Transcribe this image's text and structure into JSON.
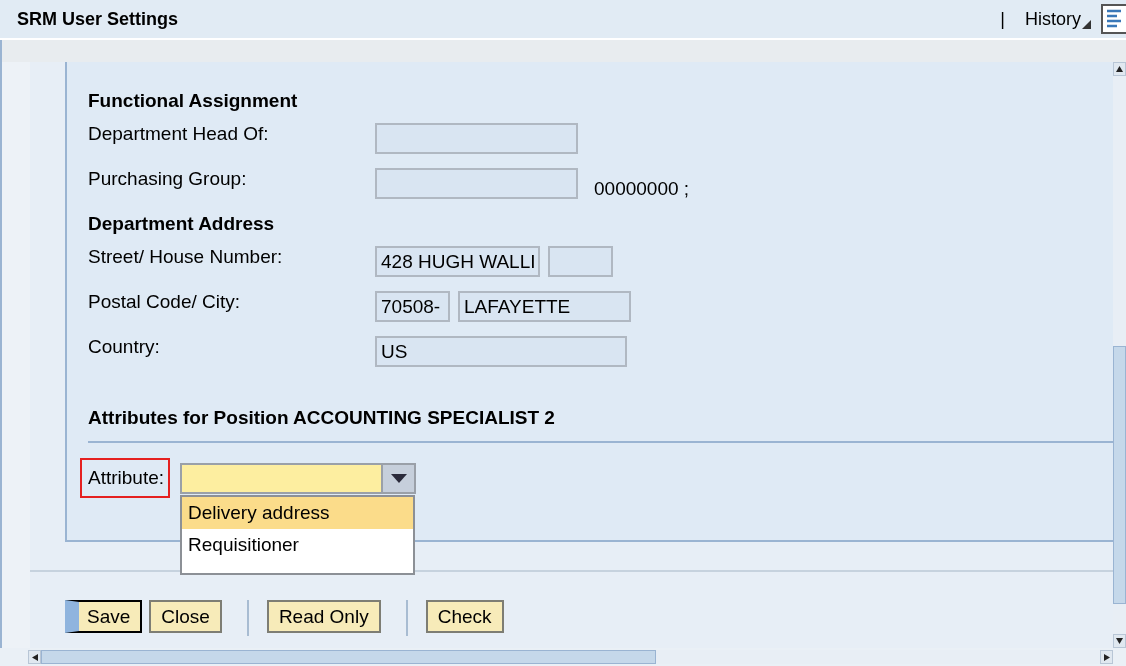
{
  "window": {
    "title": "SRM User Settings"
  },
  "header": {
    "separator": "|",
    "history": "History"
  },
  "sections": [
    {
      "heading": "Functional Assignment",
      "rows": [
        {
          "label": "Department Head Of:"
        },
        {
          "label": "Purchasing Group:",
          "after": "00000000 ;"
        }
      ]
    },
    {
      "heading": "Department Address",
      "rows": [
        {
          "label": "Street/ House Number:",
          "values": [
            "428 HUGH WALLI"
          ]
        },
        {
          "label": "Postal Code/ City:",
          "values": [
            "70508-",
            "LAFAYETTE"
          ]
        },
        {
          "label": "Country:",
          "values": [
            "US"
          ]
        }
      ]
    }
  ],
  "attributes": {
    "heading": "Attributes for Position ACCOUNTING SPECIALIST 2",
    "label": "Attribute:",
    "options": [
      {
        "label": "Delivery address",
        "selected": true
      },
      {
        "label": "Requisitioner",
        "selected": false
      }
    ]
  },
  "buttons": [
    {
      "label": "Save",
      "focused": true
    },
    {
      "label": "Close",
      "focused": false
    },
    {
      "label": "Read Only",
      "focused": false
    },
    {
      "label": "Check",
      "focused": false
    }
  ]
}
